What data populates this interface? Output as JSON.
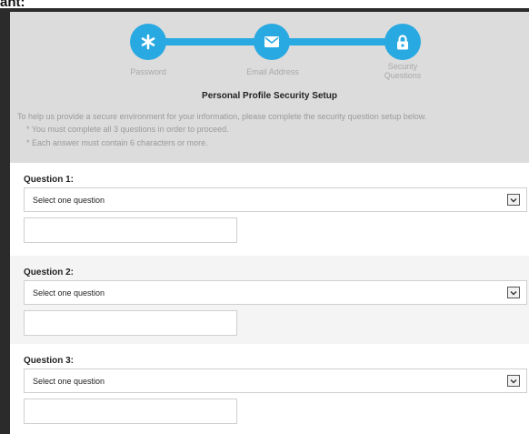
{
  "cropped_heading": "ant:",
  "steps": [
    {
      "label": "Password",
      "icon": "asterisk-icon"
    },
    {
      "label": "Email Address",
      "icon": "envelope-icon"
    },
    {
      "label_line1": "Security",
      "label_line2": "Questions",
      "icon": "lock-icon"
    }
  ],
  "header": {
    "title": "Personal Profile Security Setup",
    "intro": "To help us provide a secure environment for your information, please complete the security question setup below.",
    "note1": "* You must complete all 3 questions in order to proceed.",
    "note2": "* Each answer must contain 6 characters or more."
  },
  "questions": [
    {
      "label": "Question 1:",
      "selected": "Select one question",
      "answer": ""
    },
    {
      "label": "Question 2:",
      "selected": "Select one question",
      "answer": ""
    },
    {
      "label": "Question 3:",
      "selected": "Select one question",
      "answer": ""
    }
  ],
  "colors": {
    "accent": "#29a9e1",
    "header_bg": "#dcdcdc",
    "alt_row": "#f4f4f4"
  }
}
